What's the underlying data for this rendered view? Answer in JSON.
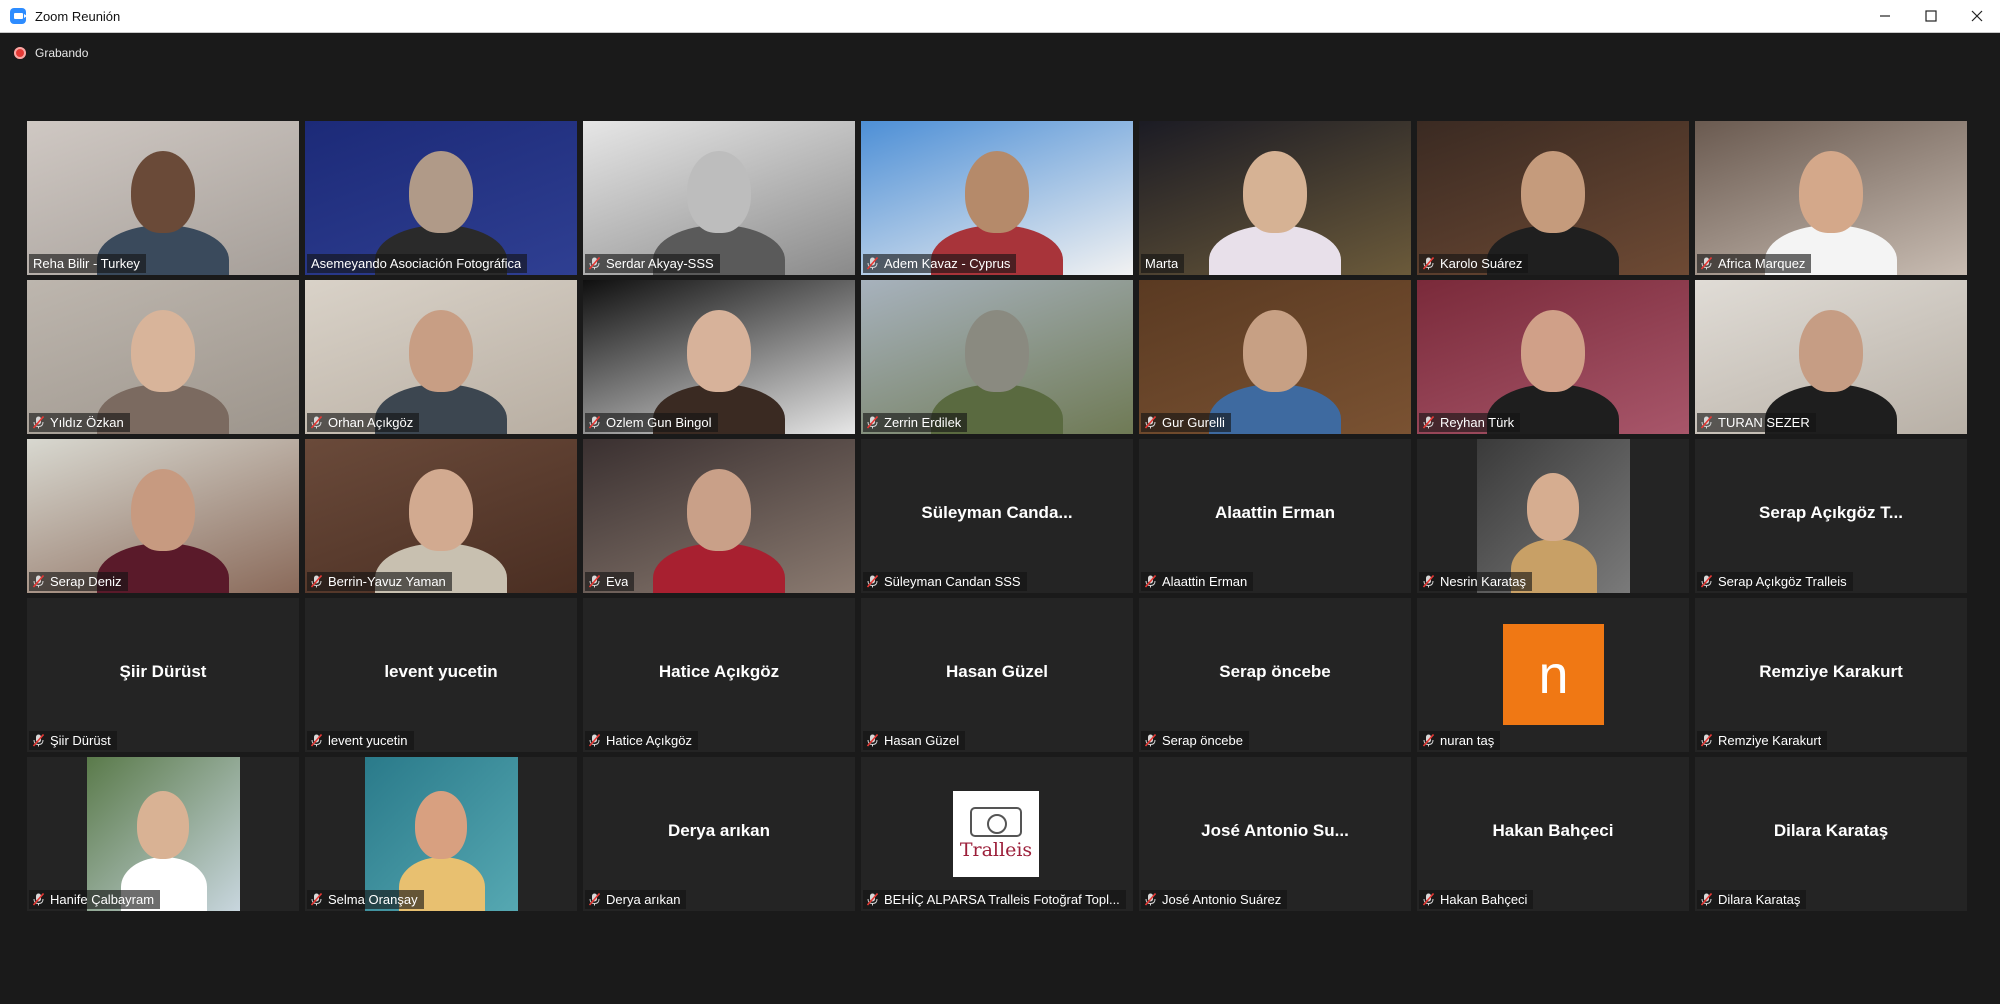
{
  "window": {
    "title": "Zoom Reunión",
    "controls": {
      "minimize": "—",
      "maximize": "☐",
      "close": "✕"
    }
  },
  "recording": {
    "label": "Grabando"
  },
  "colors": {
    "active_speaker": "#b8d94a",
    "muted_icon": "#e53935",
    "background": "#1a1a1a",
    "tile": "#242424",
    "avatar_n": "#f07814"
  },
  "participants": [
    {
      "name": "Reha Bilir - Turkey",
      "video": true,
      "muted": false,
      "active": true
    },
    {
      "name": "Asemeyando Asociación Fotográfica",
      "video": true,
      "muted": false
    },
    {
      "name": "Serdar Akyay-SSS",
      "video": true,
      "muted": true
    },
    {
      "name": "Adem Kavaz - Cyprus",
      "video": true,
      "muted": true
    },
    {
      "name": "Marta",
      "video": true,
      "muted": false
    },
    {
      "name": "Karolo Suárez",
      "video": true,
      "muted": true
    },
    {
      "name": "Africa Marquez",
      "video": true,
      "muted": true
    },
    {
      "name": "Yıldız Özkan",
      "video": true,
      "muted": true
    },
    {
      "name": "Orhan Açıkgöz",
      "video": true,
      "muted": true
    },
    {
      "name": "Ozlem Gun Bingol",
      "video": true,
      "muted": true
    },
    {
      "name": "Zerrin Erdilek",
      "video": true,
      "muted": true
    },
    {
      "name": "Gur Gurelli",
      "video": true,
      "muted": true
    },
    {
      "name": "Reyhan Türk",
      "video": true,
      "muted": true
    },
    {
      "name": "TURAN SEZER",
      "video": true,
      "muted": true
    },
    {
      "name": "Serap Deniz",
      "video": true,
      "muted": true
    },
    {
      "name": "Berrin-Yavuz Yaman",
      "video": true,
      "muted": true
    },
    {
      "name": "Eva",
      "video": true,
      "muted": true
    },
    {
      "name": "Süleyman Candan SSS",
      "display": "Süleyman Canda...",
      "video": false,
      "muted": true
    },
    {
      "name": "Alaattin Erman",
      "display": "Alaattin Erman",
      "video": false,
      "muted": true
    },
    {
      "name": "Nesrin Karataş",
      "video": false,
      "photo": true,
      "muted": true
    },
    {
      "name": "Serap Açıkgöz Tralleis",
      "display": "Serap Açıkgöz T...",
      "video": false,
      "muted": true
    },
    {
      "name": "Şiir Dürüst",
      "display": "Şiir Dürüst",
      "video": false,
      "muted": true
    },
    {
      "name": "levent yucetin",
      "display": "levent yucetin",
      "video": false,
      "muted": true
    },
    {
      "name": "Hatice Açıkgöz",
      "display": "Hatice Açıkgöz",
      "video": false,
      "muted": true
    },
    {
      "name": "Hasan Güzel",
      "display": "Hasan Güzel",
      "video": false,
      "muted": true
    },
    {
      "name": "Serap öncebe",
      "display": "Serap öncebe",
      "video": false,
      "muted": true
    },
    {
      "name": "nuran taş",
      "avatar_letter": "n",
      "video": false,
      "muted": true
    },
    {
      "name": "Remziye Karakurt",
      "display": "Remziye Karakurt",
      "video": false,
      "muted": true
    },
    {
      "name": "Hanife Çalbayram",
      "video": false,
      "photo": true,
      "muted": true
    },
    {
      "name": "Selma Oranşay",
      "video": false,
      "photo": true,
      "muted": true
    },
    {
      "name": "Derya  arıkan",
      "display": "Derya  arıkan",
      "video": false,
      "muted": true
    },
    {
      "name": "BEHİÇ ALPARSA Tralleis Fotoğraf Topl...",
      "logo_text": "Tralleis",
      "video": false,
      "muted": true
    },
    {
      "name": "José Antonio Suárez",
      "display": "José Antonio Su...",
      "video": false,
      "muted": true
    },
    {
      "name": "Hakan Bahçeci",
      "display": "Hakan Bahçeci",
      "video": false,
      "muted": true
    },
    {
      "name": "Dilara Karataş",
      "display": "Dilara Karataş",
      "video": false,
      "muted": true
    }
  ]
}
